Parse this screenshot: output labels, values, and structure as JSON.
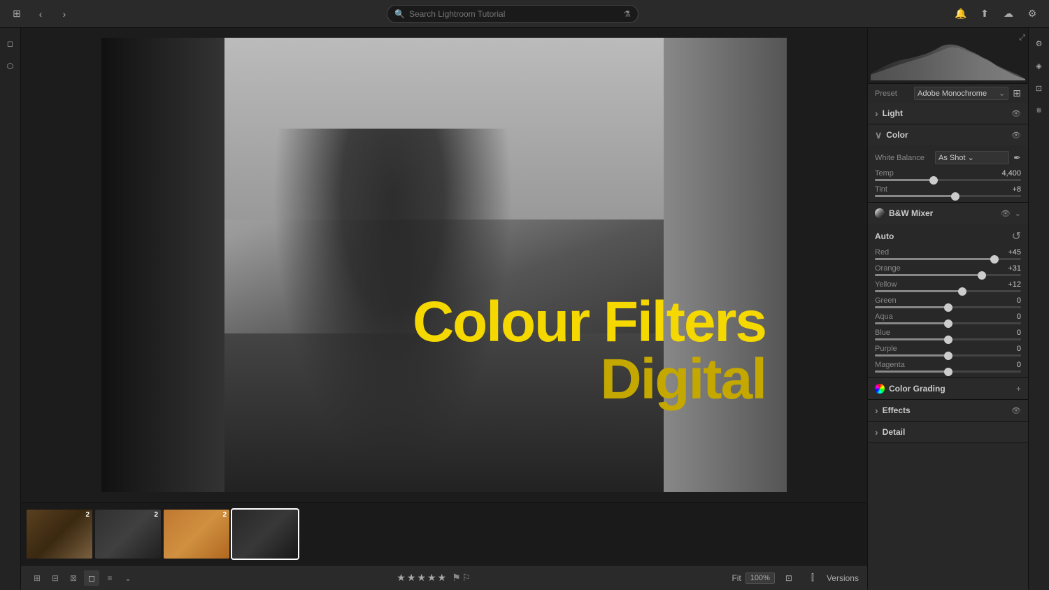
{
  "app": {
    "title": "Lightroom Tutorial"
  },
  "topbar": {
    "back_btn": "‹",
    "forward_btn": "›",
    "search_placeholder": "Search Lightroom Tutorial",
    "grid_icon": "⊞",
    "bell_icon": "🔔",
    "upload_icon": "⬆",
    "cloud_icon": "☁",
    "settings_icon": "⚙"
  },
  "right_panel": {
    "preset_label": "Preset",
    "preset_value": "Adobe Monochrome",
    "sections": {
      "light": {
        "label": "Light",
        "expanded": false
      },
      "color": {
        "label": "Color",
        "expanded": true,
        "white_balance": {
          "label": "White Balance",
          "value": "As Shot"
        },
        "temp": {
          "label": "Temp",
          "value": "4,400",
          "percent": 40
        },
        "tint": {
          "label": "Tint",
          "value": "+8",
          "percent": 55
        }
      },
      "bw_mixer": {
        "label": "B&W Mixer",
        "auto_label": "Auto",
        "sliders": [
          {
            "label": "Red",
            "value": "+45",
            "percent": 82
          },
          {
            "label": "Orange",
            "value": "+31",
            "percent": 73
          },
          {
            "label": "Yellow",
            "value": "+12",
            "percent": 60
          },
          {
            "label": "Green",
            "value": "0",
            "percent": 50
          },
          {
            "label": "Aqua",
            "value": "0",
            "percent": 50
          },
          {
            "label": "Blue",
            "value": "0",
            "percent": 50
          },
          {
            "label": "Purple",
            "value": "0",
            "percent": 50
          },
          {
            "label": "Magenta",
            "value": "0",
            "percent": 50
          }
        ]
      },
      "color_grading": {
        "label": "Color Grading"
      },
      "effects": {
        "label": "Effects",
        "expanded": false
      },
      "detail": {
        "label": "Detail"
      }
    }
  },
  "image_overlay": {
    "line1": "Colour Filters",
    "line2": "Digital"
  },
  "thumbnails": [
    {
      "badge": "2",
      "active": false,
      "color": "thumb-1"
    },
    {
      "badge": "2",
      "active": false,
      "color": "thumb-2"
    },
    {
      "badge": "2",
      "active": false,
      "color": "thumb-3"
    },
    {
      "badge": "",
      "active": true,
      "color": "thumb-4"
    }
  ],
  "bottom_bar": {
    "zoom_label": "Fit",
    "zoom_value": "100%",
    "versions_label": "Versions"
  },
  "stars": [
    "★",
    "★",
    "★",
    "★",
    "★"
  ]
}
